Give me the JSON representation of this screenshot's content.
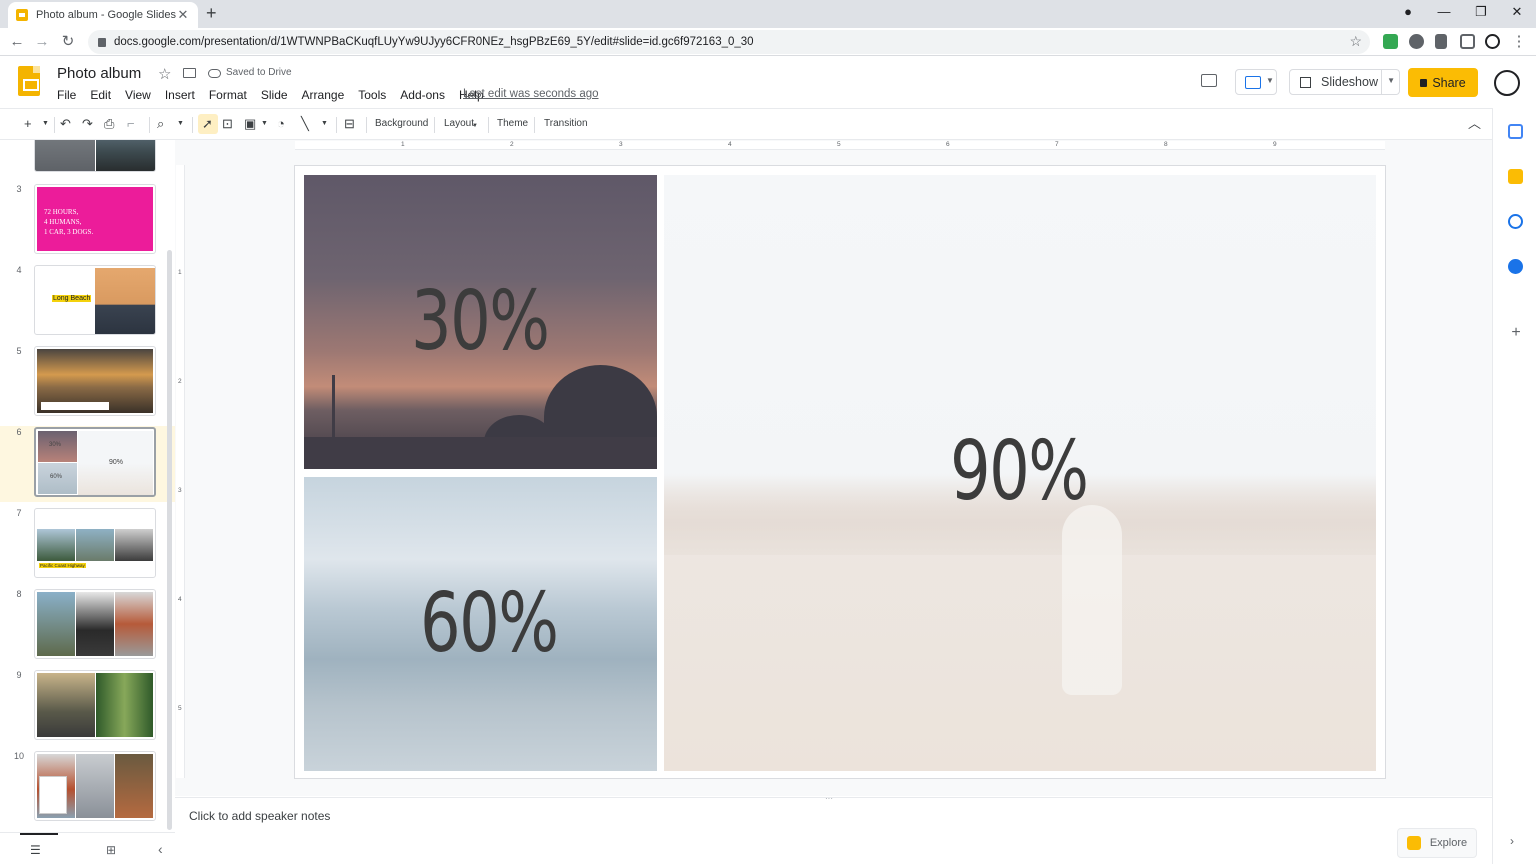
{
  "browser": {
    "tab_title": "Photo album - Google Slides",
    "url": "docs.google.com/presentation/d/1WTWNPBaCKuqfLUyYw9UJyy6CFR0NEz_hsgPBzE69_5Y/edit#slide=id.gc6f972163_0_30"
  },
  "app": {
    "doc_title": "Photo album",
    "saved_status": "Saved to Drive",
    "menu": [
      "File",
      "Edit",
      "View",
      "Insert",
      "Format",
      "Slide",
      "Arrange",
      "Tools",
      "Add-ons",
      "Help"
    ],
    "last_edit": "Last edit was seconds ago",
    "slideshow_label": "Slideshow",
    "share_label": "Share",
    "accent": "#fbbc04"
  },
  "toolbar": {
    "background": "Background",
    "layout": "Layout",
    "theme": "Theme",
    "transition": "Transition"
  },
  "filmstrip": {
    "numbers": [
      "3",
      "4",
      "5",
      "6",
      "7",
      "8",
      "9",
      "10"
    ],
    "slide3_text": "72 HOURS,\n4 HUMANS,\n1 CAR, 3 DOGS.",
    "slide4_text": "Long Beach",
    "slide6_left": "30%",
    "slide6_left2": "60%",
    "slide6_right": "90%",
    "slide7_text": "Pacific Coast Highway",
    "active_index": "6"
  },
  "ruler": {
    "h": [
      "1",
      "2",
      "3",
      "4",
      "5",
      "6",
      "7",
      "8",
      "9"
    ],
    "v": [
      "1",
      "2",
      "3",
      "4",
      "5"
    ]
  },
  "slide": {
    "stat_top_left": "30%",
    "stat_bottom_left": "60%",
    "stat_right": "90%"
  },
  "notes": {
    "placeholder": "Click to add speaker notes",
    "explore_label": "Explore"
  }
}
